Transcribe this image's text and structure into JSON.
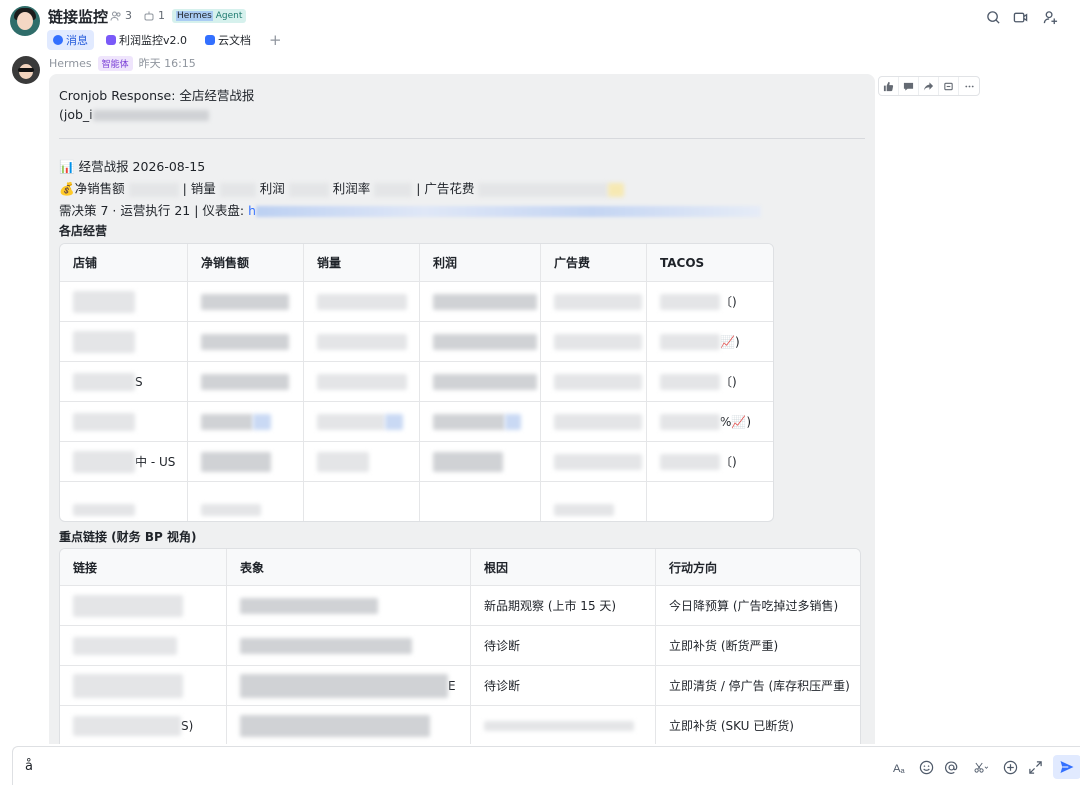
{
  "header": {
    "title": "链接监控",
    "member_count": "3",
    "bot_count": "1",
    "agent_tag_highlight": "Hermes",
    "agent_tag_rest": " Agent"
  },
  "tabs": [
    {
      "label": "消息",
      "color": "#245bdb"
    },
    {
      "label": "利润监控v2.0",
      "color": "#7a5af8"
    },
    {
      "label": "云文档",
      "color": "#3370ff"
    }
  ],
  "tab_add": "+",
  "message": {
    "sender": "Hermes",
    "sender_badge": "智能体",
    "time": "昨天 16:15",
    "line1": "Cronjob Response: 全店经营战报",
    "line2": "(job_i",
    "report_title_icon": "📊",
    "report_title": "经营战报 2026-08-15",
    "metrics_icon": "💰",
    "metric_labels": [
      "净销售额",
      "| 销量",
      "利润",
      "利润率",
      "| 广告花费"
    ],
    "line_decisions": "需决策 7 · 运营执行 21 | 仪表盘: ",
    "dashboard_link_fragment": "h",
    "section1_title": "各店经营",
    "store_table": {
      "headers": [
        "店铺",
        "净销售额",
        "销量",
        "利润",
        "广告费",
        "TACOS"
      ],
      "visible_fragments": [
        {
          "row": 0,
          "col": 5,
          "text": "〔)"
        },
        {
          "row": 1,
          "col": 5,
          "text": "📈)"
        },
        {
          "row": 2,
          "col": 0,
          "text": "S"
        },
        {
          "row": 2,
          "col": 5,
          "text": "〔)"
        },
        {
          "row": 3,
          "col": 5,
          "text": "%📈)"
        },
        {
          "row": 4,
          "col": 0,
          "text": "中 - US"
        },
        {
          "row": 4,
          "col": 5,
          "text": "〔)"
        }
      ]
    },
    "section2_title": "重点链接 (财务 BP 视角)",
    "link_table": {
      "headers": [
        "链接",
        "表象",
        "根因",
        "行动方向"
      ],
      "rows": [
        {
          "link": "",
          "symptom": "",
          "cause": "新品期观察 (上市 15 天)",
          "action": "今日降预算 (广告吃掉过多销售)"
        },
        {
          "link": "",
          "symptom": "",
          "cause": "待诊断",
          "action": "立即补货 (断货严重)"
        },
        {
          "link": "",
          "symptom": "E",
          "cause": "待诊断",
          "action": "立即清货 / 停广告 (库存积压严重)"
        },
        {
          "link": "S)",
          "symptom": "",
          "cause": "",
          "action": "立即补货 (SKU 已断货)"
        }
      ]
    }
  },
  "input": {
    "value": "å"
  },
  "icons": {
    "header": [
      "search-icon",
      "video-call-icon",
      "add-member-icon"
    ],
    "message_tools": [
      "thumbs-up-icon",
      "comment-icon",
      "forward-icon",
      "pin-icon",
      "more-icon"
    ],
    "input": [
      "text-format-icon",
      "emoji-icon",
      "mention-icon",
      "scissors-icon",
      "add-icon",
      "expand-icon",
      "send-icon"
    ]
  },
  "colors": {
    "accent": "#3370ff",
    "bubble_bg": "#eff0f1"
  }
}
